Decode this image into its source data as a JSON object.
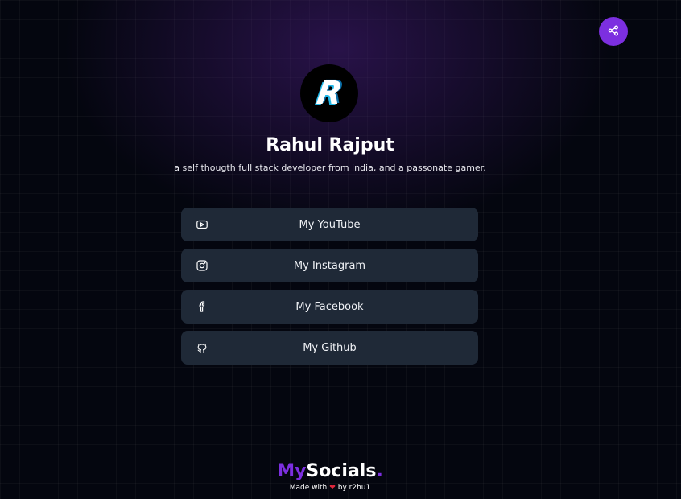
{
  "profile": {
    "avatar_letter": "R",
    "name": "Rahul Rajput",
    "bio": "a self thougth full stack developer from india, and a passonate gamer."
  },
  "share": {
    "icon": "share-icon"
  },
  "links": [
    {
      "label": "My YouTube",
      "icon": "youtube-icon"
    },
    {
      "label": "My Instagram",
      "icon": "instagram-icon"
    },
    {
      "label": "My Facebook",
      "icon": "facebook-icon"
    },
    {
      "label": "My Github",
      "icon": "github-icon"
    }
  ],
  "footer": {
    "brand_my": "My",
    "brand_socials": "Socials",
    "brand_dot": ".",
    "made_with": "Made with",
    "heart": "❤",
    "by": "by r2hu1"
  },
  "colors": {
    "accent": "#7c2fe0",
    "background": "#04060f",
    "card": "#1f2937",
    "heart": "#e0263c"
  }
}
